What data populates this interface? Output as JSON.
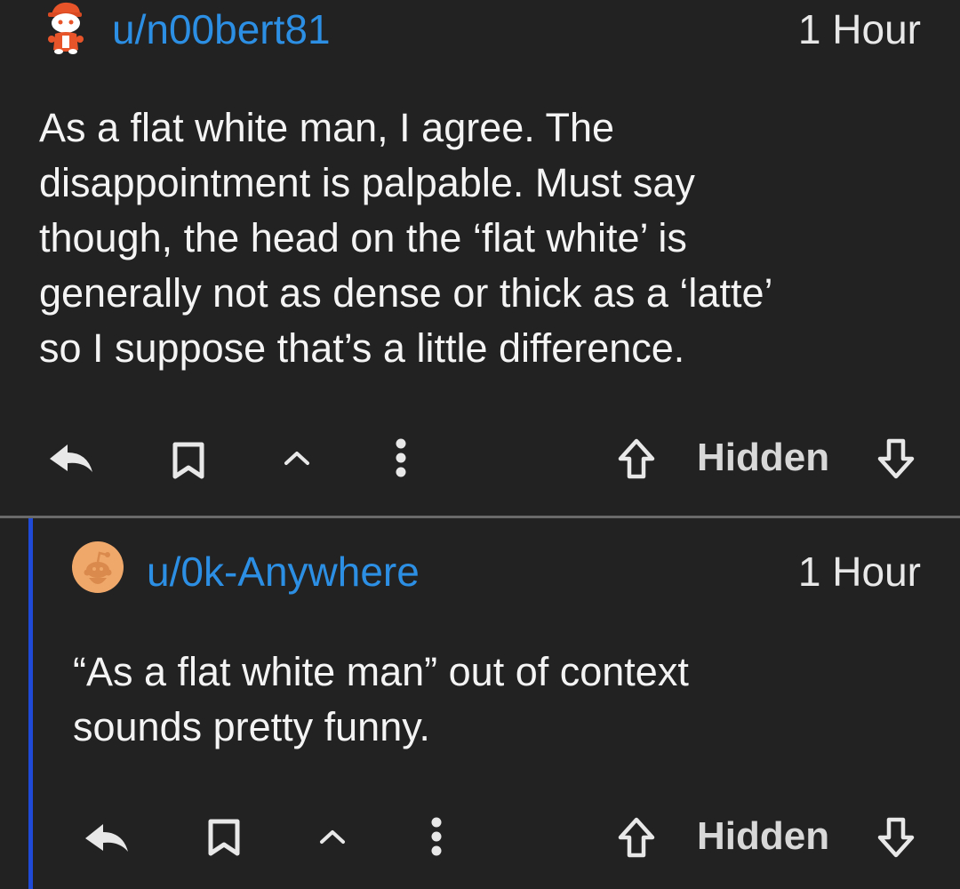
{
  "comments": [
    {
      "username": "u/n00bert81",
      "time": "1 Hour",
      "body_lines": [
        "As a flat white man, I agree. The",
        "disappointment is palpable. Must say",
        "though, the head on the ‘flat white’ is",
        "generally not as dense or thick as a ‘latte’",
        "so I suppose that’s a little difference."
      ],
      "score": "Hidden",
      "avatar_icon": "snoo-avatar-icon"
    },
    {
      "username": "u/0k-Anywhere",
      "time": "1 Hour",
      "body_lines": [
        "“As a flat white man” out of context",
        "sounds pretty funny."
      ],
      "score": "Hidden",
      "avatar_icon": "snoo-avatar-icon"
    }
  ],
  "colors": {
    "background": "#222222",
    "username": "#2d8fe3",
    "thread_line": "#1f4ad8",
    "text": "#f4f4f4"
  }
}
